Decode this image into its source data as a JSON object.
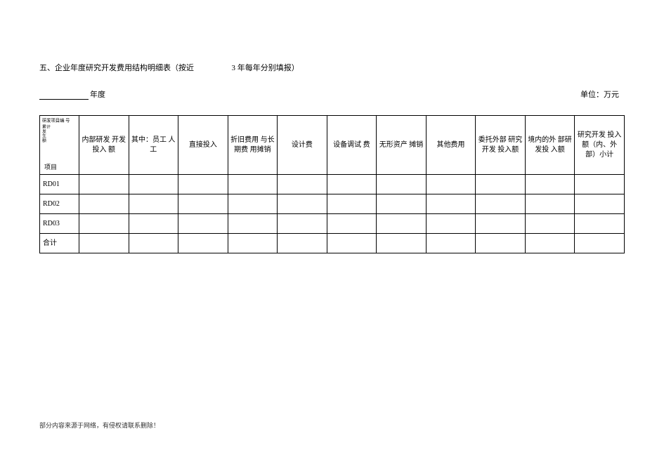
{
  "title": {
    "part1": "五、企业年度研究开发费用结构明细表（按近",
    "part2": "3 年每年分别填报）"
  },
  "subheader": {
    "year_suffix": "年度",
    "unit": "单位：万元"
  },
  "table": {
    "left_head": {
      "line1": "研发项目编 号",
      "line2": "累计\n发\n生\n额",
      "bottom": "项目"
    },
    "columns": [
      "内部研发 开发投入 额",
      "其中：员工 人工",
      "直接投入",
      "折旧费用 与长期费 用摊销",
      "设计费",
      "设备调试 费",
      "无形资产 摊销",
      "其他费用",
      "委托外部 研究开发 投入额",
      "境内的外 部研发投 入额",
      "研究开发 投入额（内、外 部）小计"
    ],
    "rows": [
      {
        "label": "RD01"
      },
      {
        "label": "RD02"
      },
      {
        "label": "RD03"
      },
      {
        "label": "合计"
      }
    ]
  },
  "footer": "部分内容来源于网络，有侵权请联系删除！"
}
